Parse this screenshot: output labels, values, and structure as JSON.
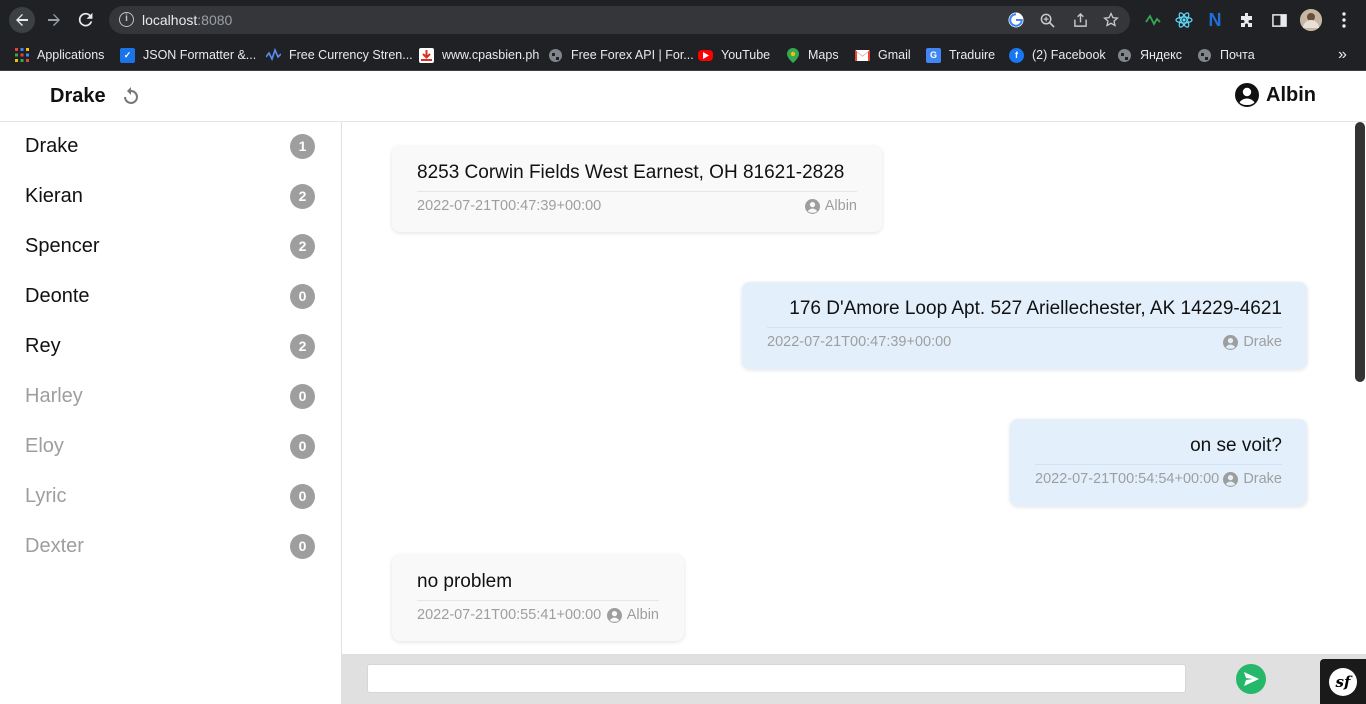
{
  "browser": {
    "url_host": "localhost",
    "url_port": ":8080",
    "bookmarks": [
      {
        "label": "Applications",
        "icon": "apps-grid-icon",
        "color": "#4285f4"
      },
      {
        "label": "JSON Formatter &...",
        "icon": "check-icon",
        "color": "#1a73e8"
      },
      {
        "label": "Free Currency Stren...",
        "icon": "chart-icon",
        "color": "#3b82f6"
      },
      {
        "label": "www.cpasbien.ph",
        "icon": "download-icon",
        "color": "#d93025"
      },
      {
        "label": "Free Forex API | For...",
        "icon": "globe-icon",
        "color": "#80868b"
      },
      {
        "label": "YouTube",
        "icon": "youtube-icon",
        "color": "#ff0000"
      },
      {
        "label": "Maps",
        "icon": "maps-pin-icon",
        "color": "#34a853"
      },
      {
        "label": "Gmail",
        "icon": "gmail-icon",
        "color": "#ea4335"
      },
      {
        "label": "Traduire",
        "icon": "translate-icon",
        "color": "#4285f4"
      },
      {
        "label": "(2) Facebook",
        "icon": "facebook-icon",
        "color": "#1877f2"
      },
      {
        "label": "Яндекс",
        "icon": "globe-icon",
        "color": "#80868b"
      },
      {
        "label": "Почта",
        "icon": "globe-icon",
        "color": "#80868b"
      }
    ],
    "more_bookmarks": "»"
  },
  "header": {
    "conversation_title": "Drake",
    "current_user": "Albin"
  },
  "contacts": [
    {
      "name": "Drake",
      "count": "1",
      "online": true
    },
    {
      "name": "Kieran",
      "count": "2",
      "online": true
    },
    {
      "name": "Spencer",
      "count": "2",
      "online": true
    },
    {
      "name": "Deonte",
      "count": "0",
      "online": true
    },
    {
      "name": "Rey",
      "count": "2",
      "online": true
    },
    {
      "name": "Harley",
      "count": "0",
      "online": false
    },
    {
      "name": "Eloy",
      "count": "0",
      "online": false
    },
    {
      "name": "Lyric",
      "count": "0",
      "online": false
    },
    {
      "name": "Dexter",
      "count": "0",
      "online": false
    }
  ],
  "messages": [
    {
      "text": "8253 Corwin Fields West Earnest, OH 81621-2828",
      "timestamp": "2022-07-21T00:47:39+00:00",
      "author": "Albin",
      "direction": "in"
    },
    {
      "text": "176 D'Amore Loop Apt. 527 Ariellechester, AK 14229-4621",
      "timestamp": "2022-07-21T00:47:39+00:00",
      "author": "Drake",
      "direction": "out"
    },
    {
      "text": "on se voit?",
      "timestamp": "2022-07-21T00:54:54+00:00",
      "author": "Drake",
      "direction": "out"
    },
    {
      "text": "no problem",
      "timestamp": "2022-07-21T00:55:41+00:00",
      "author": "Albin",
      "direction": "in"
    }
  ],
  "composer": {
    "placeholder": "",
    "value": ""
  },
  "colors": {
    "send_button": "#26b86a",
    "outgoing_bubble": "#e3f0fc",
    "incoming_bubble": "#f9f9f9",
    "badge": "#9e9e9e"
  }
}
